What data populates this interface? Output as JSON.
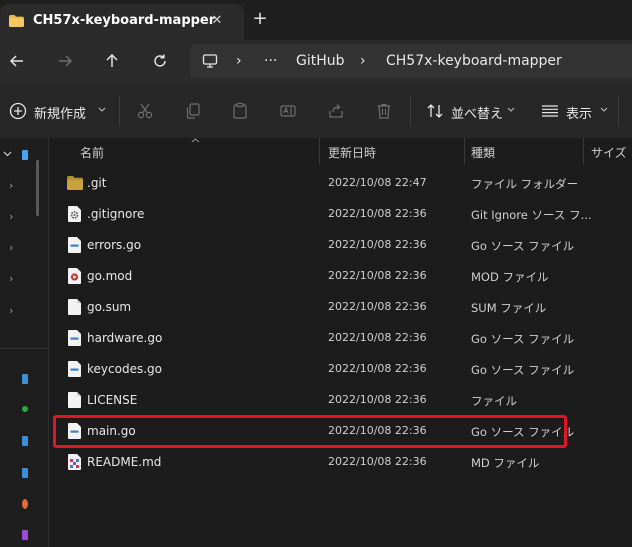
{
  "window": {
    "tab_title": "CH57x-keyboard-mapper",
    "close_glyph": "✕",
    "new_tab_glyph": "+"
  },
  "breadcrumb": {
    "more": "···",
    "segments": [
      "GitHub",
      "CH57x-keyboard-mapper"
    ],
    "separator": "›"
  },
  "toolbar": {
    "new_label": "新規作成",
    "sort_label": "並べ替え",
    "view_label": "表示",
    "more_glyph": "···"
  },
  "columns": {
    "name": "名前",
    "modified": "更新日時",
    "type": "種類",
    "size": "サイズ"
  },
  "files": [
    {
      "name": ".git",
      "modified": "2022/10/08 22:47",
      "type": "ファイル フォルダー",
      "icon": "folder-icon"
    },
    {
      "name": ".gitignore",
      "modified": "2022/10/08 22:36",
      "type": "Git Ignore ソース フ...",
      "icon": "gear-file-icon"
    },
    {
      "name": "errors.go",
      "modified": "2022/10/08 22:36",
      "type": "Go ソース ファイル",
      "icon": "go-file-icon"
    },
    {
      "name": "go.mod",
      "modified": "2022/10/08 22:36",
      "type": "MOD ファイル",
      "icon": "media-file-icon"
    },
    {
      "name": "go.sum",
      "modified": "2022/10/08 22:36",
      "type": "SUM ファイル",
      "icon": "blank-file-icon"
    },
    {
      "name": "hardware.go",
      "modified": "2022/10/08 22:36",
      "type": "Go ソース ファイル",
      "icon": "go-file-icon"
    },
    {
      "name": "keycodes.go",
      "modified": "2022/10/08 22:36",
      "type": "Go ソース ファイル",
      "icon": "go-file-icon"
    },
    {
      "name": "LICENSE",
      "modified": "2022/10/08 22:36",
      "type": "ファイル",
      "icon": "blank-file-icon"
    },
    {
      "name": "main.go",
      "modified": "2022/10/08 22:36",
      "type": "Go ソース ファイル",
      "icon": "go-file-icon",
      "highlighted": true
    },
    {
      "name": "README.md",
      "modified": "2022/10/08 22:36",
      "type": "MD ファイル",
      "icon": "markdown-file-icon"
    }
  ],
  "colors": {
    "highlight": "#e0152a",
    "accent": "#4aa3f0",
    "folder": "#c9a23c"
  }
}
